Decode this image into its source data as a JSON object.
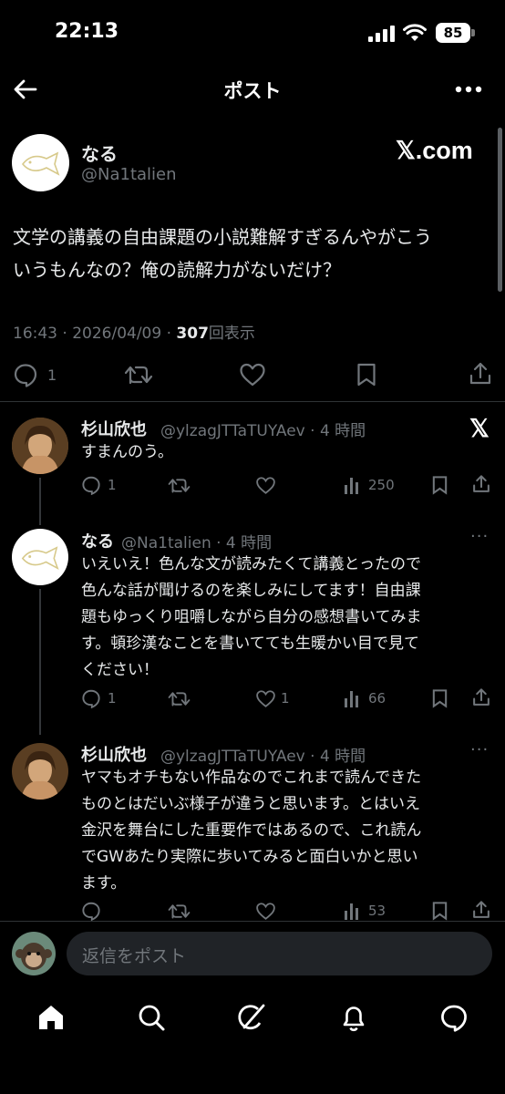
{
  "status_bar": {
    "time": "22:13",
    "battery": "85"
  },
  "header": {
    "title": "ポスト"
  },
  "post": {
    "display_name": "なる",
    "handle": "@Na1talien",
    "watermark": "𝕏.com",
    "text_line1": "文学の講義の自由課題の小説難解すぎるんやがこう",
    "text_line2": "いうもんなの？俺の読解力がないだけ？",
    "timestamp": "16:43 · 2026/04/09 · ",
    "views": "307",
    "views_label": "回表示",
    "reply_count": "1"
  },
  "replies": [
    {
      "display_name": "杉山欣也",
      "handle_time": "@ylzagJTTaTUYAev · 4 時間",
      "lines": [
        "すまんのう。"
      ],
      "reply_count": "1",
      "like_count": "",
      "view_count": "250"
    },
    {
      "display_name": "なる",
      "handle_time": "@Na1talien · 4 時間",
      "lines": [
        "いえいえ！色んな文が読みたくて講義とったので",
        "色んな話が聞けるのを楽しみにしてます！自由課",
        "題もゆっくり咀嚼しながら自分の感想書いてみま",
        "す。頓珍漢なことを書いてても生暖かい目で見て",
        "ください！"
      ],
      "reply_count": "1",
      "like_count": "1",
      "view_count": "66"
    },
    {
      "display_name": "杉山欣也",
      "handle_time": "@ylzagJTTaTUYAev · 4 時間",
      "lines": [
        "ヤマもオチもない作品なのでこれまで読んできた",
        "ものとはだいぶ様子が違うと思います。とはいえ",
        "金沢を舞台にした重要作ではあるので、これ読ん",
        "でGWあたり実際に歩いてみると面白いかと思い",
        "ます。"
      ],
      "reply_count": "",
      "like_count": "",
      "view_count": "53"
    }
  ],
  "composer": {
    "placeholder": "返信をポスト"
  },
  "colors": {
    "background": "#000000",
    "text": "#e7e9ea",
    "muted": "#71767b",
    "divider": "#2f3336"
  }
}
